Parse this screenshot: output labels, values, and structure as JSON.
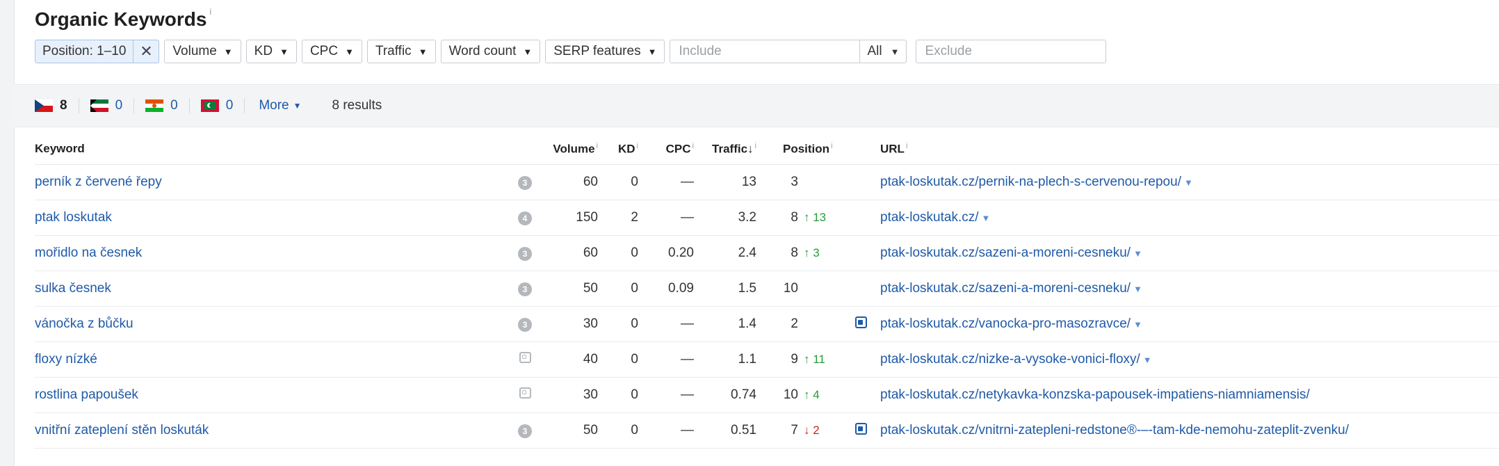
{
  "header": {
    "title": "Organic Keywords",
    "title_info": "i"
  },
  "filters": {
    "position": {
      "label": "Position: 1–10",
      "clear": "✕"
    },
    "dropdowns": [
      {
        "name": "volume",
        "label": "Volume",
        "caret": "▼"
      },
      {
        "name": "kd",
        "label": "KD",
        "caret": "▼"
      },
      {
        "name": "cpc",
        "label": "CPC",
        "caret": "▼"
      },
      {
        "name": "traffic",
        "label": "Traffic",
        "caret": "▼"
      },
      {
        "name": "word-count",
        "label": "Word count",
        "caret": "▼"
      },
      {
        "name": "serp-features",
        "label": "SERP features",
        "caret": "▼"
      }
    ],
    "include_placeholder": "Include",
    "include_mode": "All",
    "include_mode_caret": "▼",
    "exclude_placeholder": "Exclude"
  },
  "countries": [
    {
      "name": "cz",
      "count": "8"
    },
    {
      "name": "kw",
      "count": "0"
    },
    {
      "name": "ne",
      "count": "0"
    },
    {
      "name": "mv",
      "count": "0"
    }
  ],
  "more_label": "More",
  "more_caret": "▼",
  "results_text": "8 results",
  "table": {
    "columns": {
      "keyword": "Keyword",
      "volume": "Volume",
      "kd": "KD",
      "cpc": "CPC",
      "traffic": "Traffic",
      "traffic_sort": "↓",
      "position": "Position",
      "url": "URL",
      "info": "i"
    },
    "url_caret": "▼",
    "rows": [
      {
        "keyword": "perník z červené řepy",
        "serp": "3",
        "volume": "60",
        "kd": "0",
        "cpc": "—",
        "traffic": "13",
        "position": "3",
        "change": "",
        "url": "ptak-loskutak.cz/pernik-na-plech-s-cervenou-repou/"
      },
      {
        "keyword": "ptak loskutak",
        "serp": "4",
        "volume": "150",
        "kd": "2",
        "cpc": "—",
        "traffic": "3.2",
        "position": "8",
        "change": "↑ 13",
        "url": "ptak-loskutak.cz/"
      },
      {
        "keyword": "mořidlo na česnek",
        "serp": "3",
        "volume": "60",
        "kd": "0",
        "cpc": "0.20",
        "traffic": "2.4",
        "position": "8",
        "change": "↑ 3",
        "url": "ptak-loskutak.cz/sazeni-a-moreni-cesneku/"
      },
      {
        "keyword": "sulka česnek",
        "serp": "3",
        "volume": "50",
        "kd": "0",
        "cpc": "0.09",
        "traffic": "1.5",
        "position": "10",
        "change": "",
        "url": "ptak-loskutak.cz/sazeni-a-moreni-cesneku/"
      },
      {
        "keyword": "vánočka z bůčku",
        "serp": "3",
        "volume": "30",
        "kd": "0",
        "cpc": "—",
        "traffic": "1.4",
        "position": "2",
        "change": "",
        "url": "ptak-loskutak.cz/vanocka-pro-masozravce/"
      },
      {
        "keyword": "floxy nízké",
        "serp": "",
        "volume": "40",
        "kd": "0",
        "cpc": "—",
        "traffic": "1.1",
        "position": "9",
        "change": "↑ 11",
        "url": "ptak-loskutak.cz/nizke-a-vysoke-vonici-floxy/"
      },
      {
        "keyword": "rostlina papoušek",
        "serp": "",
        "volume": "30",
        "kd": "0",
        "cpc": "—",
        "traffic": "0.74",
        "position": "10",
        "change": "↑ 4",
        "url": "ptak-loskutak.cz/netykavka-konzska-papousek-impatiens-niamniamensis/"
      },
      {
        "keyword": "vnitřní zateplení stěn loskuták",
        "serp": "3",
        "volume": "50",
        "kd": "0",
        "cpc": "—",
        "traffic": "0.51",
        "position": "7",
        "change": "↓ 2",
        "url": "ptak-loskutak.cz/vnitrni-zatepleni-redstone®-–-tam-kde-nemohu-zateplit-zvenku/"
      }
    ]
  }
}
